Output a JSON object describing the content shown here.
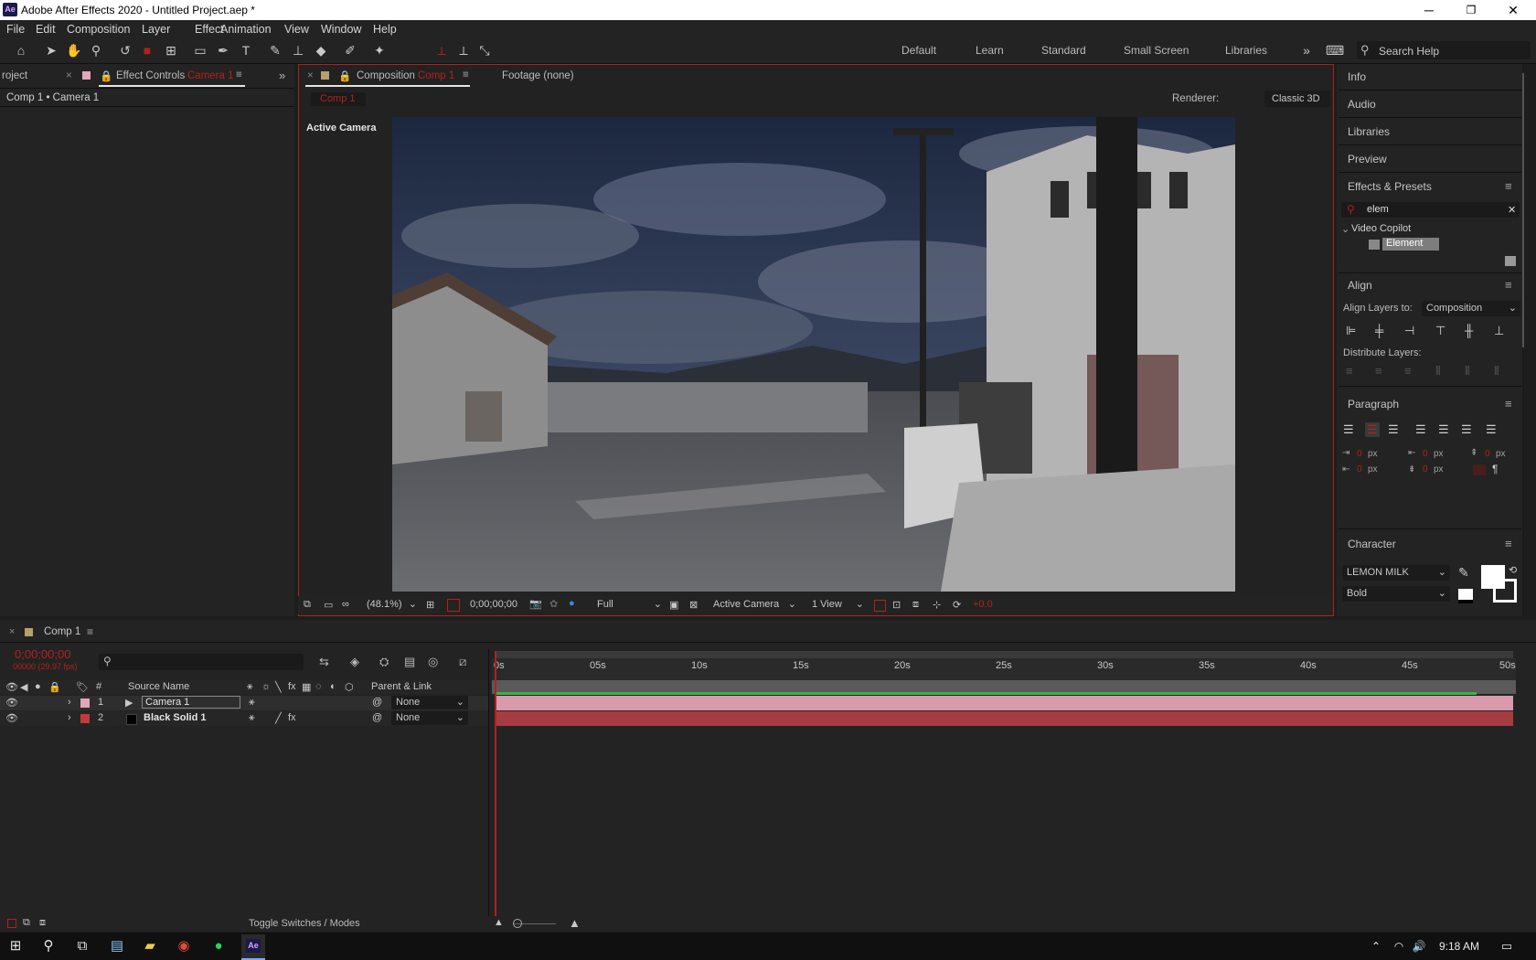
{
  "window": {
    "app_icon_text": "Ae",
    "title": "Adobe After Effects 2020 - Untitled Project.aep *",
    "controls": [
      "─",
      "❐",
      "✕"
    ]
  },
  "menu": [
    "File",
    "Edit",
    "Composition",
    "Layer",
    "Effect",
    "Animation",
    "View",
    "Window",
    "Help"
  ],
  "workspaces": [
    "Default",
    "Learn",
    "Standard",
    "Small Screen",
    "Libraries"
  ],
  "search_help": {
    "placeholder": "Search Help"
  },
  "left_panel": {
    "tab_project": "roject",
    "tab_effect_controls": "Effect Controls",
    "tab_effect_controls_target": "Camera 1",
    "path": "Comp 1 • Camera 1"
  },
  "comp_panel": {
    "tab_label": "Composition",
    "tab_target": "Comp 1",
    "footage_label": "Footage (none)",
    "comp_chip": "Comp 1",
    "renderer_label": "Renderer:",
    "renderer_value": "Classic 3D",
    "view_label": "Active Camera",
    "bottom_bar": {
      "zoom": "(48.1%)",
      "timecode": "0;00;00;00",
      "resolution": "Full",
      "camera": "Active Camera",
      "views": "1 View",
      "offset": "+0.0"
    }
  },
  "right_panel": {
    "items": [
      "Info",
      "Audio",
      "Libraries",
      "Preview"
    ],
    "effects_presets": {
      "title": "Effects & Presets",
      "search_value": "elem",
      "folder": "Video Copilot",
      "effect": "Element"
    },
    "align": {
      "title": "Align",
      "align_to_label": "Align Layers to:",
      "align_to_value": "Composition",
      "distribute_label": "Distribute Layers:"
    },
    "paragraph": {
      "title": "Paragraph",
      "unit": "px",
      "values": [
        "0",
        "0",
        "0",
        "0",
        "0"
      ]
    },
    "character": {
      "title": "Character",
      "font": "LEMON MILK",
      "style": "Bold"
    }
  },
  "timeline": {
    "comp_tab": "Comp 1",
    "timecode": "0;00;00;00",
    "fps_info": "00000 (29.97 fps)",
    "columns": {
      "number": "#",
      "source_name": "Source Name",
      "parent_link": "Parent & Link"
    },
    "layers": [
      {
        "num": "1",
        "name": "Camera 1",
        "parent": "None",
        "label_color": "#e4a6b8",
        "bar_color": "#d99aae"
      },
      {
        "num": "2",
        "name": "Black Solid 1",
        "parent": "None",
        "label_color": "#c23b3b",
        "bar_color": "#a73b42"
      }
    ],
    "ruler_labels": [
      "0s",
      "05s",
      "10s",
      "15s",
      "20s",
      "25s",
      "30s",
      "35s",
      "40s",
      "45s",
      "50s"
    ],
    "toggle_label": "Toggle Switches / Modes"
  },
  "taskbar": {
    "time": "9:18 AM"
  }
}
